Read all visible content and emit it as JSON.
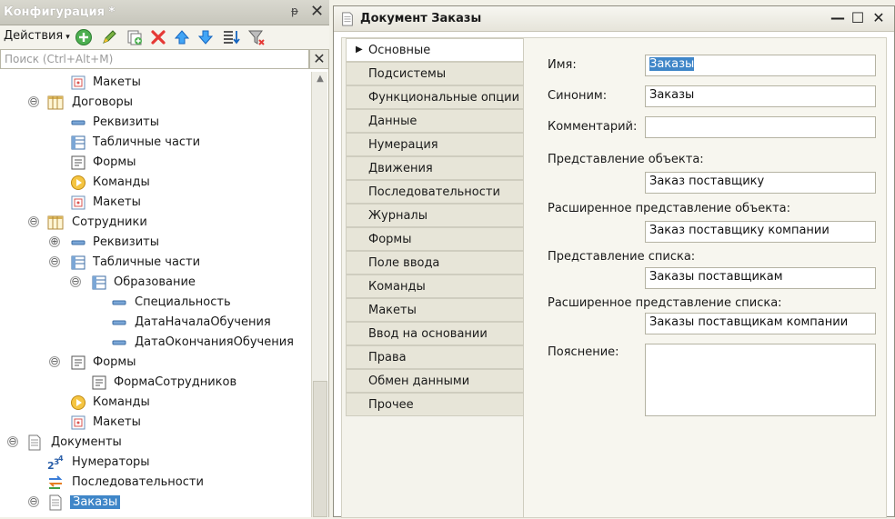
{
  "config_panel": {
    "title": "Конфигурация *",
    "pin_glyph": "ᵽ",
    "close_glyph": "✕",
    "toolbar": {
      "actions_label": "Действия",
      "actions_caret": "▾",
      "buttons": [
        "add-icon",
        "edit-icon",
        "copy-icon",
        "delete-icon",
        "move-up-icon",
        "move-down-icon",
        "sort-icon",
        "filter-icon"
      ]
    },
    "search": {
      "placeholder": "Поиск (Ctrl+Alt+M)",
      "value": "",
      "clear_glyph": "✕"
    },
    "tree": [
      {
        "label": "Макеты",
        "icon": "layout-icon"
      },
      {
        "label": "Договоры",
        "icon": "catalog-icon",
        "toggle": "⊖"
      },
      {
        "label": "Реквизиты",
        "icon": "attribute-icon"
      },
      {
        "label": "Табличные части",
        "icon": "tabular-icon"
      },
      {
        "label": "Формы",
        "icon": "form-icon"
      },
      {
        "label": "Команды",
        "icon": "command-icon"
      },
      {
        "label": "Макеты",
        "icon": "layout-icon"
      },
      {
        "label": "Сотрудники",
        "icon": "catalog-icon",
        "toggle": "⊖"
      },
      {
        "label": "Реквизиты",
        "icon": "attribute-icon",
        "toggle": "⊕"
      },
      {
        "label": "Табличные части",
        "icon": "tabular-icon",
        "toggle": "⊖"
      },
      {
        "label": "Образование",
        "icon": "tabular-icon",
        "toggle": "⊖"
      },
      {
        "label": "Специальность",
        "icon": "attribute-icon"
      },
      {
        "label": "ДатаНачалаОбучения",
        "icon": "attribute-icon"
      },
      {
        "label": "ДатаОкончанияОбучения",
        "icon": "attribute-icon"
      },
      {
        "label": "Формы",
        "icon": "form-icon",
        "toggle": "⊖"
      },
      {
        "label": "ФормаСотрудников",
        "icon": "form-icon"
      },
      {
        "label": "Команды",
        "icon": "command-icon"
      },
      {
        "label": "Макеты",
        "icon": "layout-icon"
      },
      {
        "label": "Документы",
        "icon": "document-icon",
        "toggle": "⊖"
      },
      {
        "label": "Нумераторы",
        "icon": "numerator-icon"
      },
      {
        "label": "Последовательности",
        "icon": "sequence-icon"
      },
      {
        "label": "Заказы",
        "icon": "document-icon",
        "toggle": "⊖",
        "selected": true
      }
    ]
  },
  "doc_window": {
    "title": "Документ Заказы",
    "controls": {
      "minimize": "—",
      "maximize": "☐",
      "close": "✕"
    },
    "tabs": [
      {
        "label": "Основные",
        "active": true
      },
      {
        "label": "Подсистемы"
      },
      {
        "label": "Функциональные опции"
      },
      {
        "label": "Данные"
      },
      {
        "label": "Нумерация"
      },
      {
        "label": "Движения"
      },
      {
        "label": "Последовательности"
      },
      {
        "label": "Журналы"
      },
      {
        "label": "Формы"
      },
      {
        "label": "Поле ввода"
      },
      {
        "label": "Команды"
      },
      {
        "label": "Макеты"
      },
      {
        "label": "Ввод на основании"
      },
      {
        "label": "Права"
      },
      {
        "label": "Обмен данными"
      },
      {
        "label": "Прочее"
      }
    ],
    "active_tab_arrow": "▶",
    "form": {
      "name_label": "Имя:",
      "name_value": "Заказы",
      "synonym_label": "Синоним:",
      "synonym_value": "Заказы",
      "comment_label": "Комментарий:",
      "comment_value": "",
      "object_repr_label": "Представление объекта:",
      "object_repr_value": "Заказ поставщику",
      "ext_object_repr_label": "Расширенное представление объекта:",
      "ext_object_repr_value": "Заказ поставщику компании",
      "list_repr_label": "Представление списка:",
      "list_repr_value": "Заказы поставщикам",
      "ext_list_repr_label": "Расширенное представление списка:",
      "ext_list_repr_value": "Заказы поставщикам компании",
      "explanation_label": "Пояснение:",
      "explanation_value": ""
    }
  },
  "colors": {
    "selection": "#3f86c8",
    "panel_bg": "#f4f3ec",
    "tab_bg": "#e7e5d8"
  }
}
